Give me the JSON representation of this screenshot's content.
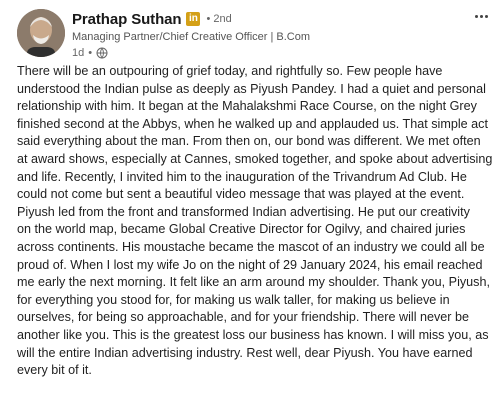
{
  "author": {
    "name": "Prathap Suthan",
    "badge": "in",
    "degree": "• 2nd",
    "headline": "Managing Partner/Chief Creative Officer | B.Com",
    "time": "1d",
    "separator": "•",
    "visibility_icon": "globe-icon"
  },
  "menu": {
    "icon": "more-horizontal-icon"
  },
  "post": {
    "lines": [
      "There will be an outpouring of grief today, and rightfully so. Few people have",
      "understood the Indian pulse as deeply as Piyush Pandey. I had a quiet and personal",
      "relationship with him. It began at the Mahalakshmi Race Course, on the night Grey",
      "finished second at the Abbys, when he walked up and applauded us. That simple act",
      "said everything about the man. From then on, our bond was different. We met often",
      "at award shows, especially at Cannes, smoked together, and spoke about advertising",
      "and life. Recently, I invited him to the inauguration of the Trivandrum Ad Club. He",
      "could not come but sent a beautiful video message that was played at the event.",
      "Piyush led from the front and transformed Indian advertising. He put our creativity",
      "on the world map, became Global Creative Director for Ogilvy, and chaired juries",
      "across continents. His moustache became the mascot of an industry we could all be",
      "proud of. When I lost my wife Jo on the night of 29 January 2024, his email reached",
      "me early the next morning. It felt like an arm around my shoulder. Thank you, Piyush,",
      "for everything you stood for, for making us walk taller, for making us believe in",
      "ourselves, for being so approachable, and for your friendship. There will never be",
      "another like you. This is the greatest loss our business has known. I will miss you, as",
      "will the entire Indian advertising industry. Rest well, dear Piyush. You have earned",
      "every bit of it."
    ]
  },
  "colors": {
    "badge": "#d4a017",
    "text": "#1f1f1f",
    "muted": "#666666"
  }
}
